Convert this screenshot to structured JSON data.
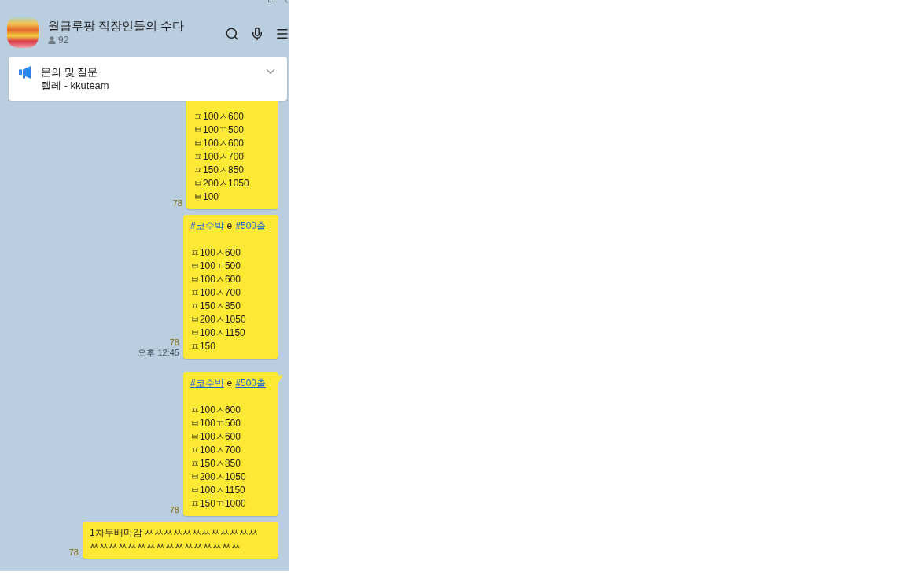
{
  "header": {
    "title": "월급루팡 직장인들의 수다",
    "member_count": "92"
  },
  "notice": {
    "title": "문의 및 질문",
    "body": "텔레 - kkuteam"
  },
  "messages": [
    {
      "cut_top": true,
      "tail": false,
      "body": "ㅍ100ㅅ600\nㅂ100ㄲ500\nㅂ100ㅅ600\nㅍ100ㅅ700\nㅍ150ㅅ850\nㅂ200ㅅ1050\nㅂ100",
      "unread": "78"
    },
    {
      "cut_top": false,
      "tail": false,
      "tags": [
        {
          "kind": "link",
          "text": "#코수박"
        },
        {
          "kind": "text",
          "text": "e"
        },
        {
          "kind": "link",
          "text": "#500출"
        }
      ],
      "body": "ㅍ100ㅅ600\nㅂ100ㄲ500\nㅂ100ㅅ600\nㅍ100ㅅ700\nㅍ150ㅅ850\nㅂ200ㅅ1050\nㅂ100ㅅ1150\nㅍ150",
      "unread": "78",
      "time": "오후 12:45"
    },
    {
      "cut_top": false,
      "tail": true,
      "tags": [
        {
          "kind": "link",
          "text": "#코수박"
        },
        {
          "kind": "text",
          "text": "e"
        },
        {
          "kind": "link",
          "text": "#500출"
        }
      ],
      "body": "ㅍ100ㅅ600\nㅂ100ㄲ500\nㅂ100ㅅ600\nㅍ100ㅅ700\nㅍ150ㅅ850\nㅂ200ㅅ1050\nㅂ100ㅅ1150\nㅍ150ㄲ1000",
      "unread": "78"
    },
    {
      "cut_top": false,
      "tail": false,
      "body": "1차두배마감 ㅆㅆㅆㅆㅆㅆㅆㅆㅆㅆㅆㅆㅆㅆㅆㅆㅆㅆㅆㅆㅆㅆㅆㅆㅆㅆㅆㅆ",
      "unread": "78"
    }
  ]
}
